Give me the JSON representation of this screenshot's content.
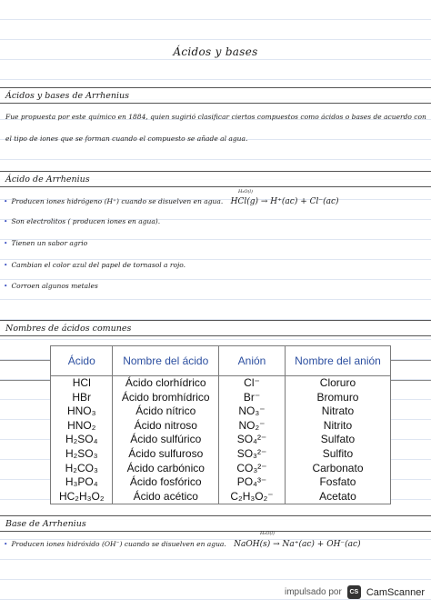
{
  "title": "Ácidos y bases",
  "arrhenius_section": {
    "header": "Ácidos y bases de Arrhenius",
    "line1": "Fue propuesta por este químico en 1884, quien sugirió clasificar ciertos compuestos como ácidos o bases de acuerdo con",
    "line2": "el tipo de iones que se forman cuando el compuesto se añade al agua."
  },
  "acid_section": {
    "header": "Ácido de Arrhenius",
    "bullets": [
      {
        "text": "Producen iones hidrógeno (H⁺) cuando se disuelven en agua.",
        "equation": "HCl(g) → H⁺(ac) + Cl⁻(ac)",
        "annotation": "H₂O(l)"
      },
      {
        "text": "Son electrolitos ( producen iones en agua)."
      },
      {
        "text": "Tienen un sabor agrio"
      },
      {
        "text": "Cambian el color azul del papel de tornasol a rojo."
      },
      {
        "text": "Corroen algunos metales"
      }
    ]
  },
  "common_acids_section": {
    "header": "Nombres de ácidos comunes",
    "columns": [
      "Ácido",
      "Nombre del ácido",
      "Anión",
      "Nombre del anión"
    ],
    "rows": [
      {
        "acid": "HCl",
        "name": "Ácido clorhídrico",
        "anion": "Cl⁻",
        "anion_name": "Cloruro"
      },
      {
        "acid": "HBr",
        "name": "Ácido bromhídrico",
        "anion": "Br⁻",
        "anion_name": "Bromuro"
      },
      {
        "acid": "HNO₃",
        "name": "Ácido nítrico",
        "anion": "NO₃⁻",
        "anion_name": "Nitrato"
      },
      {
        "acid": "HNO₂",
        "name": "Ácido nitroso",
        "anion": "NO₂⁻",
        "anion_name": "Nitrito"
      },
      {
        "acid": "H₂SO₄",
        "name": "Ácido sulfúrico",
        "anion": "SO₄²⁻",
        "anion_name": "Sulfato"
      },
      {
        "acid": "H₂SO₃",
        "name": "Ácido sulfuroso",
        "anion": "SO₃²⁻",
        "anion_name": "Sulfito"
      },
      {
        "acid": "H₂CO₃",
        "name": "Ácido carbónico",
        "anion": "CO₃²⁻",
        "anion_name": "Carbonato"
      },
      {
        "acid": "H₃PO₄",
        "name": "Ácido fosfórico",
        "anion": "PO₄³⁻",
        "anion_name": "Fosfato"
      },
      {
        "acid": "HC₂H₃O₂",
        "name": "Ácido acético",
        "anion": "C₂H₃O₂⁻",
        "anion_name": "Acetato"
      }
    ]
  },
  "base_section": {
    "header": "Base de Arrhenius",
    "bullets": [
      {
        "text": "Producen iones hidróxido (OH⁻) cuando se disuelven en agua.",
        "equation": "NaOH(s) → Na⁺(ac) + OH⁻(ac)",
        "annotation": "H₂O(l)"
      }
    ]
  },
  "footer": {
    "prefix": "impulsado por",
    "logo": "CS",
    "brand": "CamScanner"
  },
  "colors": {
    "bullet": "#3a4fc2",
    "table_header": "#2c4fa0",
    "rule": "#dfe6f2"
  }
}
